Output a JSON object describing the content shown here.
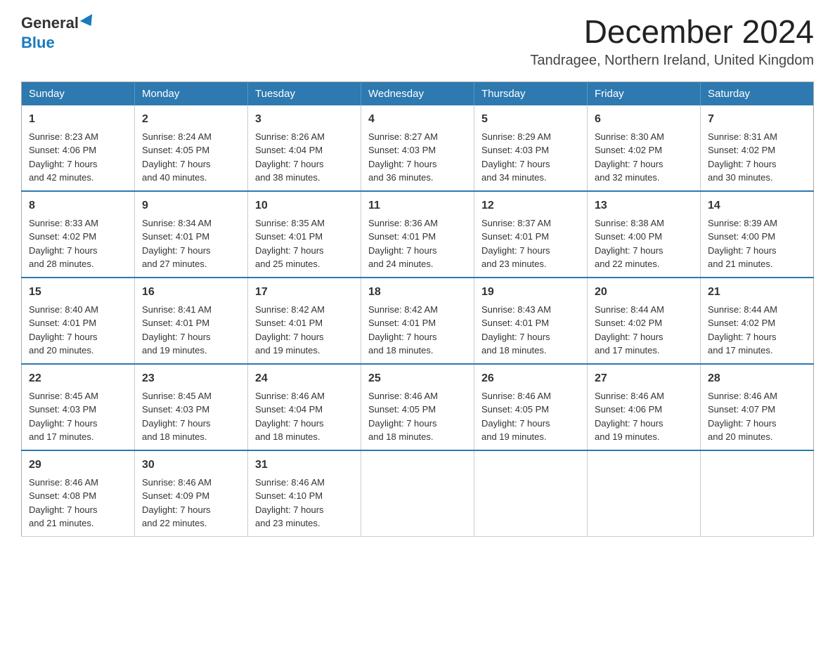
{
  "logo": {
    "general": "General",
    "blue": "Blue"
  },
  "title": "December 2024",
  "subtitle": "Tandragee, Northern Ireland, United Kingdom",
  "weekdays": [
    "Sunday",
    "Monday",
    "Tuesday",
    "Wednesday",
    "Thursday",
    "Friday",
    "Saturday"
  ],
  "weeks": [
    [
      {
        "day": "1",
        "sunrise": "Sunrise: 8:23 AM",
        "sunset": "Sunset: 4:06 PM",
        "daylight": "Daylight: 7 hours",
        "daylight2": "and 42 minutes."
      },
      {
        "day": "2",
        "sunrise": "Sunrise: 8:24 AM",
        "sunset": "Sunset: 4:05 PM",
        "daylight": "Daylight: 7 hours",
        "daylight2": "and 40 minutes."
      },
      {
        "day": "3",
        "sunrise": "Sunrise: 8:26 AM",
        "sunset": "Sunset: 4:04 PM",
        "daylight": "Daylight: 7 hours",
        "daylight2": "and 38 minutes."
      },
      {
        "day": "4",
        "sunrise": "Sunrise: 8:27 AM",
        "sunset": "Sunset: 4:03 PM",
        "daylight": "Daylight: 7 hours",
        "daylight2": "and 36 minutes."
      },
      {
        "day": "5",
        "sunrise": "Sunrise: 8:29 AM",
        "sunset": "Sunset: 4:03 PM",
        "daylight": "Daylight: 7 hours",
        "daylight2": "and 34 minutes."
      },
      {
        "day": "6",
        "sunrise": "Sunrise: 8:30 AM",
        "sunset": "Sunset: 4:02 PM",
        "daylight": "Daylight: 7 hours",
        "daylight2": "and 32 minutes."
      },
      {
        "day": "7",
        "sunrise": "Sunrise: 8:31 AM",
        "sunset": "Sunset: 4:02 PM",
        "daylight": "Daylight: 7 hours",
        "daylight2": "and 30 minutes."
      }
    ],
    [
      {
        "day": "8",
        "sunrise": "Sunrise: 8:33 AM",
        "sunset": "Sunset: 4:02 PM",
        "daylight": "Daylight: 7 hours",
        "daylight2": "and 28 minutes."
      },
      {
        "day": "9",
        "sunrise": "Sunrise: 8:34 AM",
        "sunset": "Sunset: 4:01 PM",
        "daylight": "Daylight: 7 hours",
        "daylight2": "and 27 minutes."
      },
      {
        "day": "10",
        "sunrise": "Sunrise: 8:35 AM",
        "sunset": "Sunset: 4:01 PM",
        "daylight": "Daylight: 7 hours",
        "daylight2": "and 25 minutes."
      },
      {
        "day": "11",
        "sunrise": "Sunrise: 8:36 AM",
        "sunset": "Sunset: 4:01 PM",
        "daylight": "Daylight: 7 hours",
        "daylight2": "and 24 minutes."
      },
      {
        "day": "12",
        "sunrise": "Sunrise: 8:37 AM",
        "sunset": "Sunset: 4:01 PM",
        "daylight": "Daylight: 7 hours",
        "daylight2": "and 23 minutes."
      },
      {
        "day": "13",
        "sunrise": "Sunrise: 8:38 AM",
        "sunset": "Sunset: 4:00 PM",
        "daylight": "Daylight: 7 hours",
        "daylight2": "and 22 minutes."
      },
      {
        "day": "14",
        "sunrise": "Sunrise: 8:39 AM",
        "sunset": "Sunset: 4:00 PM",
        "daylight": "Daylight: 7 hours",
        "daylight2": "and 21 minutes."
      }
    ],
    [
      {
        "day": "15",
        "sunrise": "Sunrise: 8:40 AM",
        "sunset": "Sunset: 4:01 PM",
        "daylight": "Daylight: 7 hours",
        "daylight2": "and 20 minutes."
      },
      {
        "day": "16",
        "sunrise": "Sunrise: 8:41 AM",
        "sunset": "Sunset: 4:01 PM",
        "daylight": "Daylight: 7 hours",
        "daylight2": "and 19 minutes."
      },
      {
        "day": "17",
        "sunrise": "Sunrise: 8:42 AM",
        "sunset": "Sunset: 4:01 PM",
        "daylight": "Daylight: 7 hours",
        "daylight2": "and 19 minutes."
      },
      {
        "day": "18",
        "sunrise": "Sunrise: 8:42 AM",
        "sunset": "Sunset: 4:01 PM",
        "daylight": "Daylight: 7 hours",
        "daylight2": "and 18 minutes."
      },
      {
        "day": "19",
        "sunrise": "Sunrise: 8:43 AM",
        "sunset": "Sunset: 4:01 PM",
        "daylight": "Daylight: 7 hours",
        "daylight2": "and 18 minutes."
      },
      {
        "day": "20",
        "sunrise": "Sunrise: 8:44 AM",
        "sunset": "Sunset: 4:02 PM",
        "daylight": "Daylight: 7 hours",
        "daylight2": "and 17 minutes."
      },
      {
        "day": "21",
        "sunrise": "Sunrise: 8:44 AM",
        "sunset": "Sunset: 4:02 PM",
        "daylight": "Daylight: 7 hours",
        "daylight2": "and 17 minutes."
      }
    ],
    [
      {
        "day": "22",
        "sunrise": "Sunrise: 8:45 AM",
        "sunset": "Sunset: 4:03 PM",
        "daylight": "Daylight: 7 hours",
        "daylight2": "and 17 minutes."
      },
      {
        "day": "23",
        "sunrise": "Sunrise: 8:45 AM",
        "sunset": "Sunset: 4:03 PM",
        "daylight": "Daylight: 7 hours",
        "daylight2": "and 18 minutes."
      },
      {
        "day": "24",
        "sunrise": "Sunrise: 8:46 AM",
        "sunset": "Sunset: 4:04 PM",
        "daylight": "Daylight: 7 hours",
        "daylight2": "and 18 minutes."
      },
      {
        "day": "25",
        "sunrise": "Sunrise: 8:46 AM",
        "sunset": "Sunset: 4:05 PM",
        "daylight": "Daylight: 7 hours",
        "daylight2": "and 18 minutes."
      },
      {
        "day": "26",
        "sunrise": "Sunrise: 8:46 AM",
        "sunset": "Sunset: 4:05 PM",
        "daylight": "Daylight: 7 hours",
        "daylight2": "and 19 minutes."
      },
      {
        "day": "27",
        "sunrise": "Sunrise: 8:46 AM",
        "sunset": "Sunset: 4:06 PM",
        "daylight": "Daylight: 7 hours",
        "daylight2": "and 19 minutes."
      },
      {
        "day": "28",
        "sunrise": "Sunrise: 8:46 AM",
        "sunset": "Sunset: 4:07 PM",
        "daylight": "Daylight: 7 hours",
        "daylight2": "and 20 minutes."
      }
    ],
    [
      {
        "day": "29",
        "sunrise": "Sunrise: 8:46 AM",
        "sunset": "Sunset: 4:08 PM",
        "daylight": "Daylight: 7 hours",
        "daylight2": "and 21 minutes."
      },
      {
        "day": "30",
        "sunrise": "Sunrise: 8:46 AM",
        "sunset": "Sunset: 4:09 PM",
        "daylight": "Daylight: 7 hours",
        "daylight2": "and 22 minutes."
      },
      {
        "day": "31",
        "sunrise": "Sunrise: 8:46 AM",
        "sunset": "Sunset: 4:10 PM",
        "daylight": "Daylight: 7 hours",
        "daylight2": "and 23 minutes."
      },
      null,
      null,
      null,
      null
    ]
  ]
}
